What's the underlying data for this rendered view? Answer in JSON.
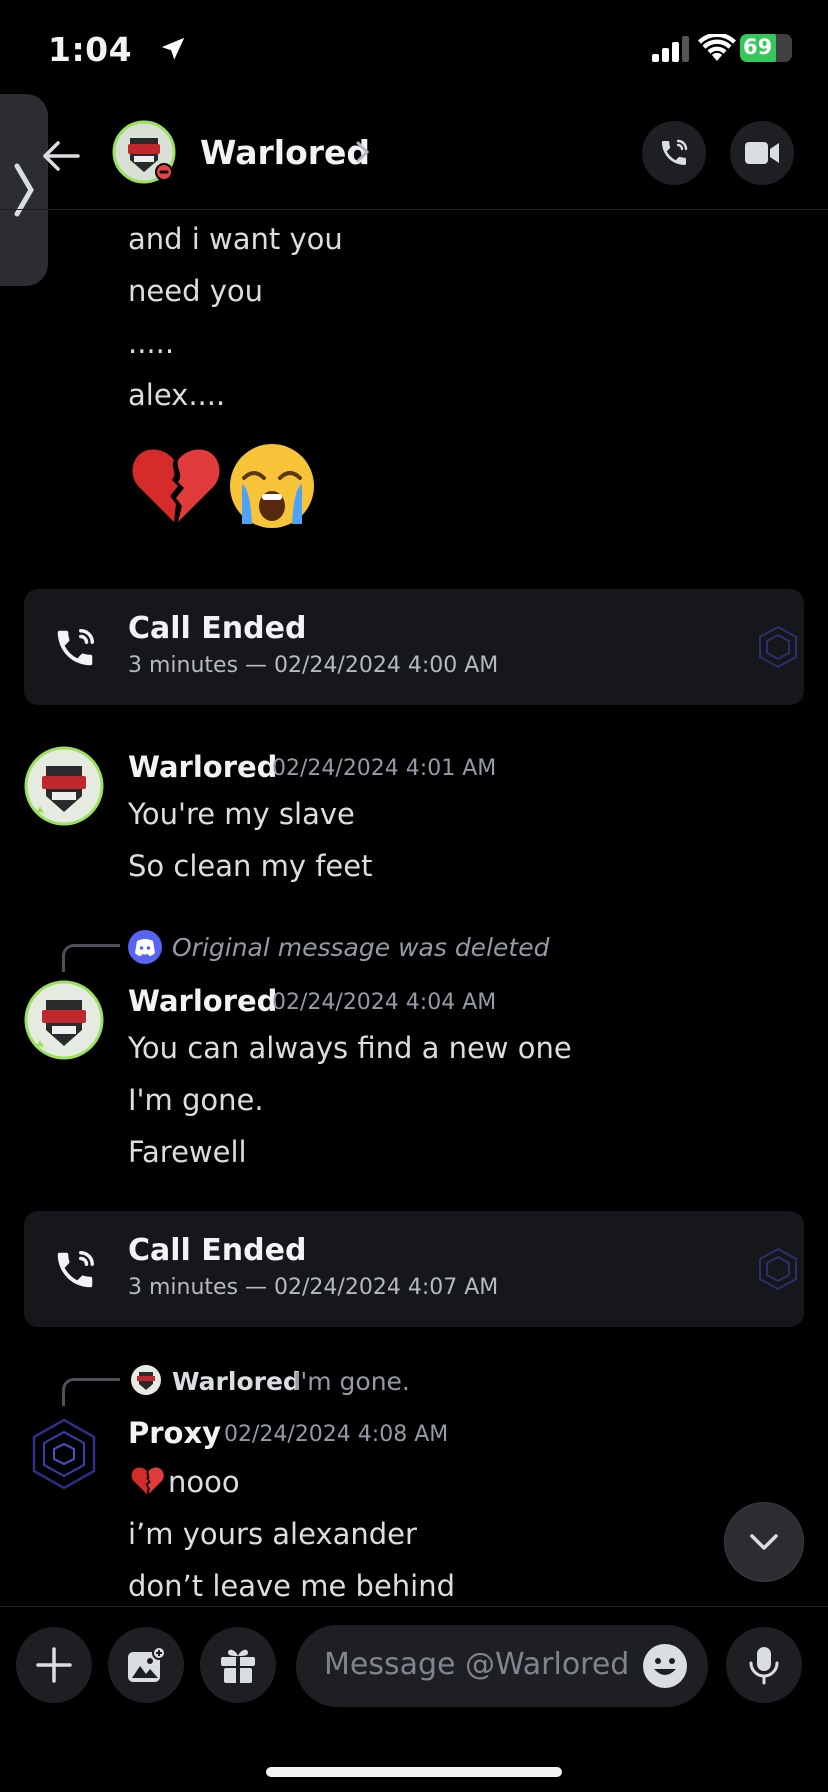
{
  "status_bar": {
    "time": "1:04",
    "battery": "69",
    "battery_level": 0.69
  },
  "header": {
    "name": "Warlored"
  },
  "messages_top": [
    "and i want you",
    "need you",
    ".....",
    "alex...."
  ],
  "emojis": [
    "broken-heart-emoji",
    "crying-face-emoji"
  ],
  "calls": [
    {
      "title": "Call Ended",
      "subtitle": "3 minutes — 02/24/2024 4:00 AM"
    },
    {
      "title": "Call Ended",
      "subtitle": "3 minutes — 02/24/2024 4:07 AM"
    }
  ],
  "msg1": {
    "author": "Warlored",
    "time": "02/24/2024 4:01 AM",
    "lines": [
      "You're my slave",
      "So clean my feet"
    ]
  },
  "msg2": {
    "reply": "Original message was deleted",
    "author": "Warlored",
    "time": "02/24/2024 4:04 AM",
    "lines": [
      "You can always find a new one",
      "I'm gone.",
      "Farewell"
    ]
  },
  "msg3": {
    "reply_author": "Warlored",
    "reply_text": "I'm gone.",
    "author": "Proxy",
    "time": "02/24/2024 4:08 AM",
    "lines": [
      "nooo",
      "i’m yours alexander",
      "don’t leave me behind"
    ]
  },
  "composer": {
    "placeholder": "Message @Warlored"
  },
  "colors": {
    "accent": "#5865f2",
    "online": "#3ba55c",
    "dnd": "#ed4245",
    "battery": "#34c759"
  }
}
